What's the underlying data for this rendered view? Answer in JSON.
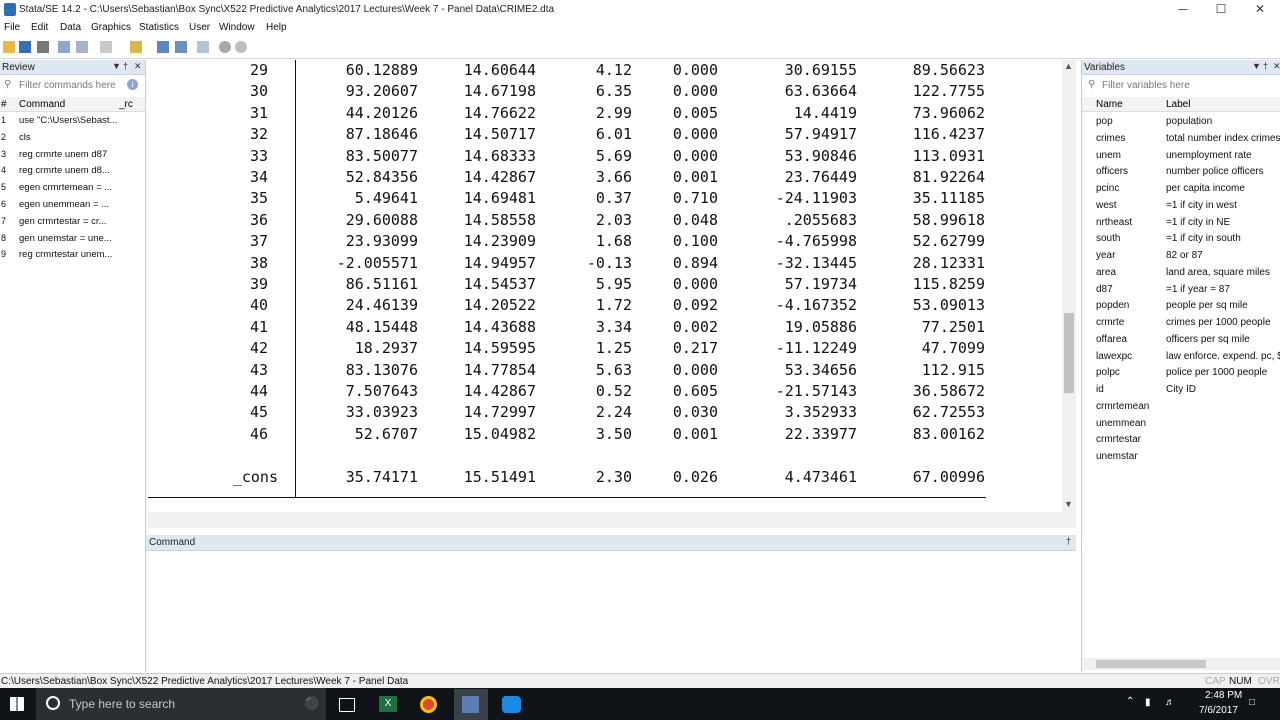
{
  "window": {
    "title": "Stata/SE 14.2 - C:\\Users\\Sebastian\\Box Sync\\X522 Predictive Analytics\\2017 Lectures\\Week 7 - Panel Data\\CRIME2.dta",
    "controls": {
      "minimize": "─",
      "maximize": "☐",
      "close": "✕"
    }
  },
  "menu": [
    "File",
    "Edit",
    "Data",
    "Graphics",
    "Statistics",
    "User",
    "Window",
    "Help"
  ],
  "review": {
    "title": "Review",
    "filter_placeholder": "Filter commands here",
    "col_command": "Command",
    "col_rc": "_rc",
    "items": [
      {
        "n": "1",
        "cmd": "use \"C:\\Users\\Sebast..."
      },
      {
        "n": "2",
        "cmd": "cls"
      },
      {
        "n": "3",
        "cmd": "reg crmrte unem d87"
      },
      {
        "n": "4",
        "cmd": "reg crmrte unem d8..."
      },
      {
        "n": "5",
        "cmd": "egen crmrtemean = ..."
      },
      {
        "n": "6",
        "cmd": "egen unemmean = ..."
      },
      {
        "n": "7",
        "cmd": "gen crmrtestar = cr..."
      },
      {
        "n": "8",
        "cmd": "gen unemstar = une..."
      },
      {
        "n": "9",
        "cmd": "reg crmrtestar unem..."
      }
    ]
  },
  "results": {
    "rows": [
      [
        "29",
        "60.12889",
        "14.60644",
        "4.12",
        "0.000",
        "30.69155",
        "89.56623"
      ],
      [
        "30",
        "93.20607",
        "14.67198",
        "6.35",
        "0.000",
        "63.63664",
        "122.7755"
      ],
      [
        "31",
        "44.20126",
        "14.76622",
        "2.99",
        "0.005",
        "14.4419",
        "73.96062"
      ],
      [
        "32",
        "87.18646",
        "14.50717",
        "6.01",
        "0.000",
        "57.94917",
        "116.4237"
      ],
      [
        "33",
        "83.50077",
        "14.68333",
        "5.69",
        "0.000",
        "53.90846",
        "113.0931"
      ],
      [
        "34",
        "52.84356",
        "14.42867",
        "3.66",
        "0.001",
        "23.76449",
        "81.92264"
      ],
      [
        "35",
        "5.49641",
        "14.69481",
        "0.37",
        "0.710",
        "-24.11903",
        "35.11185"
      ],
      [
        "36",
        "29.60088",
        "14.58558",
        "2.03",
        "0.048",
        ".2055683",
        "58.99618"
      ],
      [
        "37",
        "23.93099",
        "14.23909",
        "1.68",
        "0.100",
        "-4.765998",
        "52.62799"
      ],
      [
        "38",
        "-2.005571",
        "14.94957",
        "-0.13",
        "0.894",
        "-32.13445",
        "28.12331"
      ],
      [
        "39",
        "86.51161",
        "14.54537",
        "5.95",
        "0.000",
        "57.19734",
        "115.8259"
      ],
      [
        "40",
        "24.46139",
        "14.20522",
        "1.72",
        "0.092",
        "-4.167352",
        "53.09013"
      ],
      [
        "41",
        "48.15448",
        "14.43688",
        "3.34",
        "0.002",
        "19.05886",
        "77.2501"
      ],
      [
        "42",
        "18.2937",
        "14.59595",
        "1.25",
        "0.217",
        "-11.12249",
        "47.7099"
      ],
      [
        "43",
        "83.13076",
        "14.77854",
        "5.63",
        "0.000",
        "53.34656",
        "112.915"
      ],
      [
        "44",
        "7.507643",
        "14.42867",
        "0.52",
        "0.605",
        "-21.57143",
        "36.58672"
      ],
      [
        "45",
        "33.03923",
        "14.72997",
        "2.24",
        "0.030",
        "3.352933",
        "62.72553"
      ],
      [
        "46",
        "52.6707",
        "15.04982",
        "3.50",
        "0.001",
        "22.33977",
        "83.00162"
      ]
    ],
    "cons": [
      "_cons",
      "35.74171",
      "15.51491",
      "2.30",
      "0.026",
      "4.473461",
      "67.00996"
    ]
  },
  "command_panel": {
    "title": "Command"
  },
  "variables": {
    "title": "Variables",
    "filter_placeholder": "Filter variables here",
    "col_name": "Name",
    "col_label": "Label",
    "items": [
      {
        "name": "pop",
        "label": "population"
      },
      {
        "name": "crimes",
        "label": "total number index crimes"
      },
      {
        "name": "unem",
        "label": "unemployment rate"
      },
      {
        "name": "officers",
        "label": "number police officers"
      },
      {
        "name": "pcinc",
        "label": "per capita income"
      },
      {
        "name": "west",
        "label": "=1 if city in west"
      },
      {
        "name": "nrtheast",
        "label": "=1 if city in NE"
      },
      {
        "name": "south",
        "label": "=1 if city in south"
      },
      {
        "name": "year",
        "label": "82 or 87"
      },
      {
        "name": "area",
        "label": "land area, square miles"
      },
      {
        "name": "d87",
        "label": "=1 if year = 87"
      },
      {
        "name": "popden",
        "label": "people per sq mile"
      },
      {
        "name": "crmrte",
        "label": "crimes per 1000 people"
      },
      {
        "name": "offarea",
        "label": "officers per sq mile"
      },
      {
        "name": "lawexpc",
        "label": "law enforce. expend. pc, $"
      },
      {
        "name": "polpc",
        "label": "police per 1000 people"
      },
      {
        "name": "id",
        "label": "City ID"
      },
      {
        "name": "crmrtemean",
        "label": ""
      },
      {
        "name": "unemmean",
        "label": ""
      },
      {
        "name": "crmrtestar",
        "label": ""
      },
      {
        "name": "unemstar",
        "label": ""
      }
    ]
  },
  "status_bar": {
    "path": "C:\\Users\\Sebastian\\Box Sync\\X522 Predictive Analytics\\2017 Lectures\\Week 7 - Panel Data",
    "cap": "CAP",
    "num": "NUM",
    "ovr": "OVR"
  },
  "taskbar": {
    "search_placeholder": "Type here to search",
    "time": "2:48 PM",
    "date": "7/6/2017"
  },
  "colors": {
    "accent": "#2f6db5",
    "panel_header": "#dfe7f0",
    "taskbar": "#101318"
  }
}
